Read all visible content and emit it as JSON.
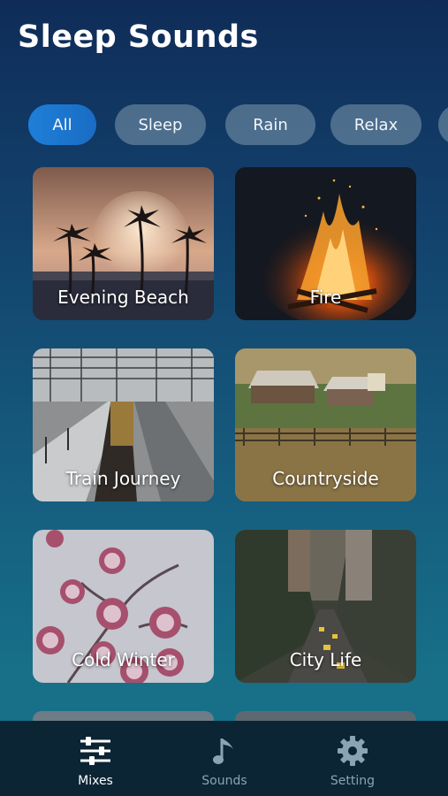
{
  "header": {
    "title": "Sleep Sounds"
  },
  "filters": [
    {
      "label": "All",
      "active": true
    },
    {
      "label": "Sleep",
      "active": false
    },
    {
      "label": "Rain",
      "active": false
    },
    {
      "label": "Relax",
      "active": false
    }
  ],
  "mixes": [
    {
      "label": "Evening Beach"
    },
    {
      "label": "Fire"
    },
    {
      "label": "Train Journey"
    },
    {
      "label": "Countryside"
    },
    {
      "label": "Cold Winter"
    },
    {
      "label": "City Life"
    }
  ],
  "nav": {
    "items": [
      {
        "label": "Mixes",
        "icon": "sliders-icon",
        "active": true
      },
      {
        "label": "Sounds",
        "icon": "music-note-icon",
        "active": false
      },
      {
        "label": "Setting",
        "icon": "gear-icon",
        "active": false
      }
    ]
  },
  "colors": {
    "accent": "#1e7fd8",
    "nav_bg": "#0b2535"
  }
}
